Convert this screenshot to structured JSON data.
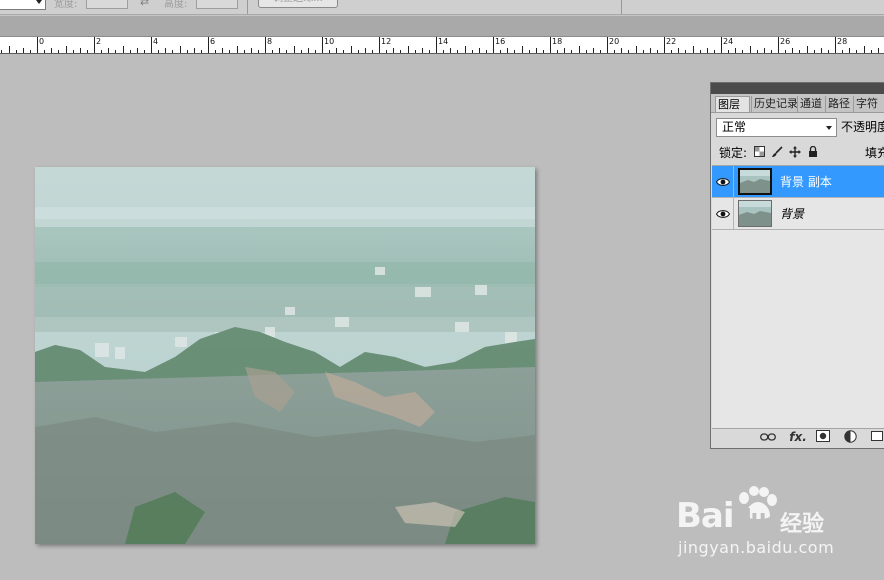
{
  "options_bar": {
    "width_label": "宽度:",
    "height_label": "高度:",
    "swap_symbol": "⇄",
    "refine_edge_button": "调整边缘..."
  },
  "ruler": {
    "labels": [
      "0",
      "2",
      "4",
      "6",
      "8",
      "10",
      "12",
      "14",
      "16",
      "18",
      "20",
      "22",
      "24",
      "26",
      "28"
    ]
  },
  "layers_panel": {
    "tabs": [
      {
        "label": "图层",
        "active": true
      },
      {
        "label": "历史记录",
        "active": false
      },
      {
        "label": "通道",
        "active": false
      },
      {
        "label": "路径",
        "active": false
      },
      {
        "label": "字符",
        "active": false
      }
    ],
    "blend_mode": "正常",
    "opacity_label": "不透明度",
    "lock_label": "锁定:",
    "fill_label": "填充",
    "layers": [
      {
        "name": "背景 副本",
        "selected": true,
        "italic": false,
        "visible": true
      },
      {
        "name": "背景",
        "selected": false,
        "italic": true,
        "visible": true
      }
    ],
    "bottom_icons": [
      "link-icon",
      "fx-icon",
      "mask-icon",
      "adjustment-icon",
      "new-group-icon"
    ],
    "fx_text": "fx.",
    "accent_color": "#3399ff"
  },
  "watermark": {
    "brand": "Bai",
    "brand_du": "du",
    "product": "经验",
    "url": "jingyan.baidu.com"
  }
}
